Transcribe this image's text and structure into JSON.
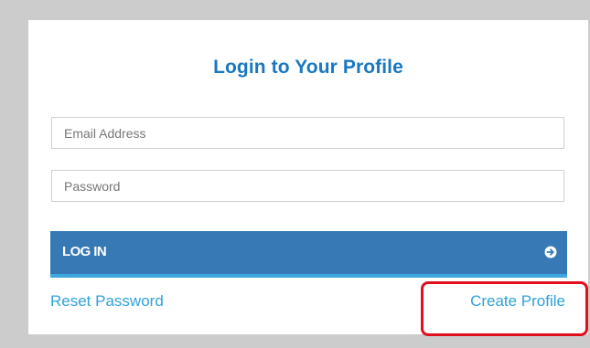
{
  "login_form": {
    "title": "Login to Your Profile",
    "email_placeholder": "Email Address",
    "password_placeholder": "Password",
    "login_button_label": "LOG IN",
    "login_button_icon": "arrow-right-circle-icon",
    "reset_password_link": "Reset Password",
    "create_profile_link": "Create Profile"
  },
  "colors": {
    "title": "#1878c2",
    "button_background": "#3679b5",
    "button_accent": "#3fa7e0",
    "link": "#2fa2d8",
    "highlight": "#e0101e",
    "page_background": "#cccccc"
  }
}
